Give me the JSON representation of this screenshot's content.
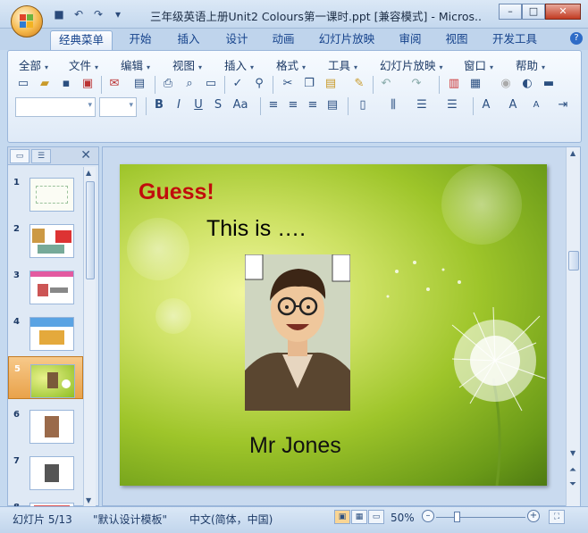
{
  "window": {
    "title": "三年级英语上册Unit2 Colours第一课时.ppt [兼容模式] - Micros..."
  },
  "ribbon_tabs": [
    {
      "label": "经典菜单",
      "active": true
    },
    {
      "label": "开始"
    },
    {
      "label": "插入"
    },
    {
      "label": "设计"
    },
    {
      "label": "动画"
    },
    {
      "label": "幻灯片放映"
    },
    {
      "label": "审阅"
    },
    {
      "label": "视图"
    },
    {
      "label": "开发工具"
    }
  ],
  "menus": [
    "全部",
    "文件",
    "编辑",
    "视图",
    "插入",
    "格式",
    "工具",
    "幻灯片放映",
    "窗口",
    "帮助"
  ],
  "toolbar_font_buttons": {
    "bold": "B",
    "italic": "I",
    "underline": "U",
    "shadow": "S",
    "case": "Aa"
  },
  "thumbnails": [
    {
      "num": "1"
    },
    {
      "num": "2"
    },
    {
      "num": "3"
    },
    {
      "num": "4"
    },
    {
      "num": "5",
      "selected": true
    },
    {
      "num": "6"
    },
    {
      "num": "7"
    },
    {
      "num": "8"
    }
  ],
  "slide": {
    "heading": "Guess!",
    "prompt": "This is ….",
    "caption": "Mr Jones"
  },
  "status": {
    "slide_counter": "幻灯片 5/13",
    "theme": "\"默认设计模板\"",
    "language": "中文(简体，中国)",
    "zoom": "50%"
  },
  "colors": {
    "heading": "#c10c0c",
    "selection": "#e9a24a"
  }
}
